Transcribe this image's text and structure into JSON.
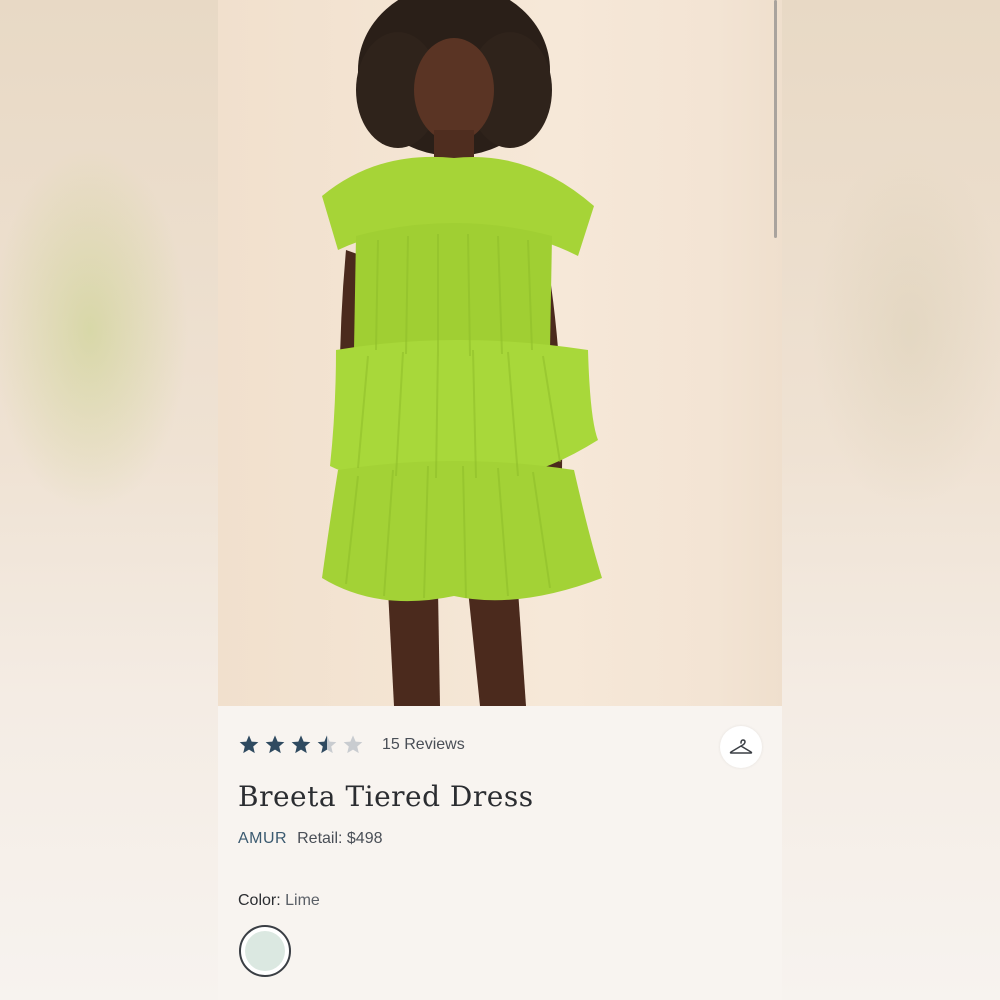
{
  "product": {
    "rating": 3.5,
    "rating_max": 5,
    "reviews_label": "15 Reviews",
    "title": "Breeta Tiered Dress",
    "brand": "AMUR",
    "retail_label": "Retail: $498",
    "color_label": "Color:",
    "color_value": "Lime",
    "swatch_color": "#dbe8e1"
  },
  "icons": {
    "rating_star": "star-icon",
    "closet": "hanger-icon"
  },
  "colors": {
    "star_filled": "#2f4a60",
    "star_empty": "#c9ccd0",
    "dress": "#a8d83a",
    "brand": "#3b5a70"
  }
}
